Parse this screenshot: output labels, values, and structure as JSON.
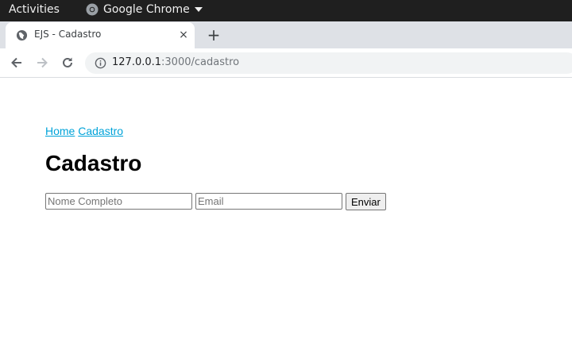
{
  "system_bar": {
    "activities": "Activities",
    "app_name": "Google Chrome"
  },
  "tab": {
    "title": "EJS - Cadastro",
    "close": "×"
  },
  "newtab": "+",
  "address": {
    "host": "127.0.0.1",
    "path": ":3000/cadastro"
  },
  "nav": {
    "home": "Home",
    "cadastro": "Cadastro"
  },
  "page": {
    "title": "Cadastro"
  },
  "form": {
    "name_placeholder": "Nome Completo",
    "email_placeholder": "Email",
    "submit_label": "Enviar"
  }
}
